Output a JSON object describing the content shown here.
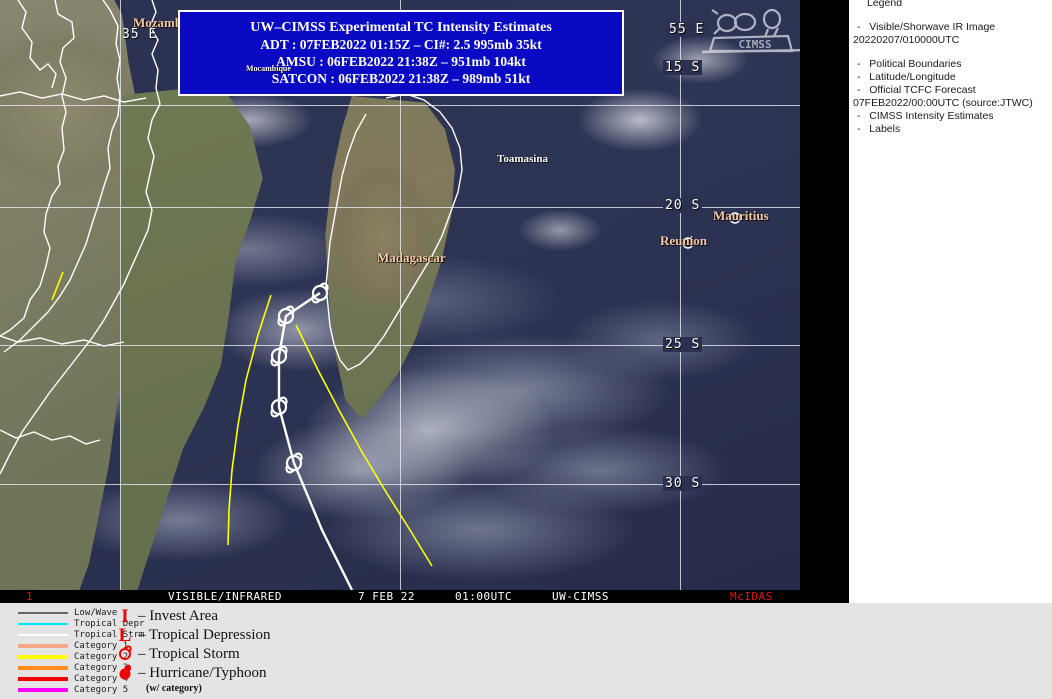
{
  "infobox": {
    "title": "UW–CIMSS Experimental TC Intensity Estimates",
    "line_adt": "ADT : 07FEB2022 01:15Z –   CI#: 2.5   995mb   35kt",
    "line_amsu": "AMSU : 06FEB2022 21:38Z –   951mb   104kt",
    "line_satcon": "SATCON : 06FEB2022 21:38Z –   989mb   51kt",
    "background_color": "#0a0ac4",
    "border_color": "#ffffff",
    "text_color": "#ffffff"
  },
  "map": {
    "labels": [
      {
        "text": "Mozambique",
        "type": "country"
      },
      {
        "text": "Mocambique",
        "type": "small"
      },
      {
        "text": "Madagascar",
        "type": "country"
      },
      {
        "text": "Toamasina",
        "type": "city"
      },
      {
        "text": "Mauritius",
        "type": "country"
      },
      {
        "text": "Reunion",
        "type": "country"
      }
    ],
    "grid_labels": [
      "35 E",
      "55 E",
      "15 S",
      "20 S",
      "25 S",
      "30 S"
    ],
    "watermark": "CIMSS",
    "forecast_track_color": "#ffffff",
    "uncertainty_cone_color": "#ffff00"
  },
  "status_bar": {
    "frame_number": "1",
    "product": "VISIBLE/INFRARED",
    "date": "7 FEB 22",
    "time": "01:00UTC",
    "source": "UW-CIMSS",
    "software": "McIDAS",
    "frame_color": "#e81010",
    "software_color": "#e81010"
  },
  "side_panel": {
    "header": "Legend",
    "items": [
      {
        "dash": "-",
        "label": "Visible/Shorwave IR Image",
        "sub": "20220207/010000UTC",
        "gap_after": true
      },
      {
        "dash": "-",
        "label": "Political Boundaries"
      },
      {
        "dash": "-",
        "label": "Latitude/Longitude"
      },
      {
        "dash": "-",
        "label": "Official TCFC Forecast",
        "sub": "07FEB2022/00:00UTC  (source:JTWC)"
      },
      {
        "dash": "-",
        "label": "CIMSS Intensity Estimates"
      },
      {
        "dash": "-",
        "label": "Labels"
      }
    ]
  },
  "bottom_legend": {
    "intensity_scale": [
      {
        "name": "Low/Wave",
        "color": "#666666",
        "thickness": 2
      },
      {
        "name": "Tropical Depr",
        "color": "#00e8f0",
        "thickness": 2
      },
      {
        "name": "Tropical Strm",
        "color": "#ffffff",
        "thickness": 2
      },
      {
        "name": "Category 1",
        "color": "#f5a884",
        "thickness": 4
      },
      {
        "name": "Category 2",
        "color": "#ffff00",
        "thickness": 4
      },
      {
        "name": "Category 3",
        "color": "#ff8c1a",
        "thickness": 4
      },
      {
        "name": "Category 4",
        "color": "#f00000",
        "thickness": 4
      },
      {
        "name": "Category 5",
        "color": "#ff00ff",
        "thickness": 4
      }
    ],
    "symbols": [
      {
        "glyph": "I",
        "label": "– Invest Area"
      },
      {
        "glyph": "L",
        "label": "– Tropical Depression"
      },
      {
        "glyph": "storm-open",
        "label": "– Tropical Storm"
      },
      {
        "glyph": "storm-filled",
        "label": "– Hurricane/Typhoon"
      }
    ],
    "symbol_note": "(w/ category)",
    "symbol_color": "#f00000"
  }
}
